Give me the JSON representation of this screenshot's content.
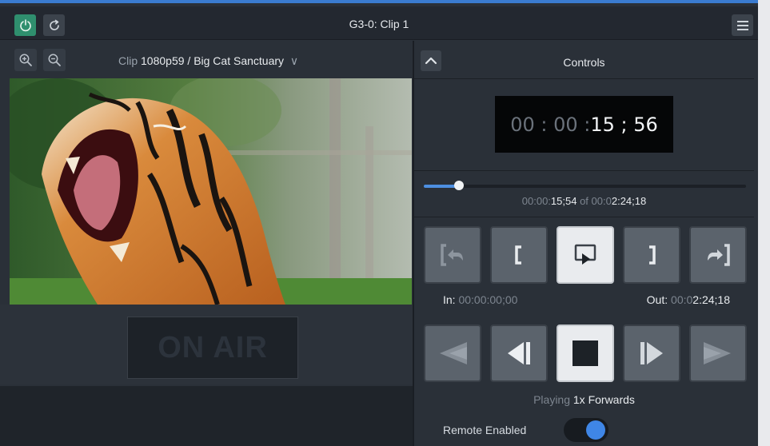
{
  "window": {
    "title": "G3-0: Clip 1"
  },
  "toolbar": {
    "power_icon": "power-icon",
    "refresh_icon": "refresh-icon",
    "menu_icon": "hamburger-menu-icon"
  },
  "clip": {
    "prefix": "Clip",
    "name": "1080p59 / Big Cat Sanctuary",
    "chevron": "∨"
  },
  "onair": {
    "label": "ON AIR"
  },
  "controls": {
    "title": "Controls",
    "timecode": {
      "dim": "00 : 00 : ",
      "bright": "15 ; 56"
    },
    "position": {
      "current_dim": "00:00:",
      "current_bright": "15;54",
      "of": " of ",
      "total_dim": "00:0",
      "total_bright": "2:24;18",
      "fraction": 0.11
    },
    "in_point": {
      "label": "In: ",
      "value": "00:00:00;00"
    },
    "out_point": {
      "label": "Out: ",
      "dim": "00:0",
      "bright": "2:24;18"
    },
    "status": {
      "prefix": "Playing ",
      "value": "1x Forwards"
    },
    "remote": {
      "label": "Remote Enabled",
      "enabled": true
    }
  },
  "colors": {
    "accent": "#3f86e6",
    "power_green": "#2f8f6e"
  }
}
